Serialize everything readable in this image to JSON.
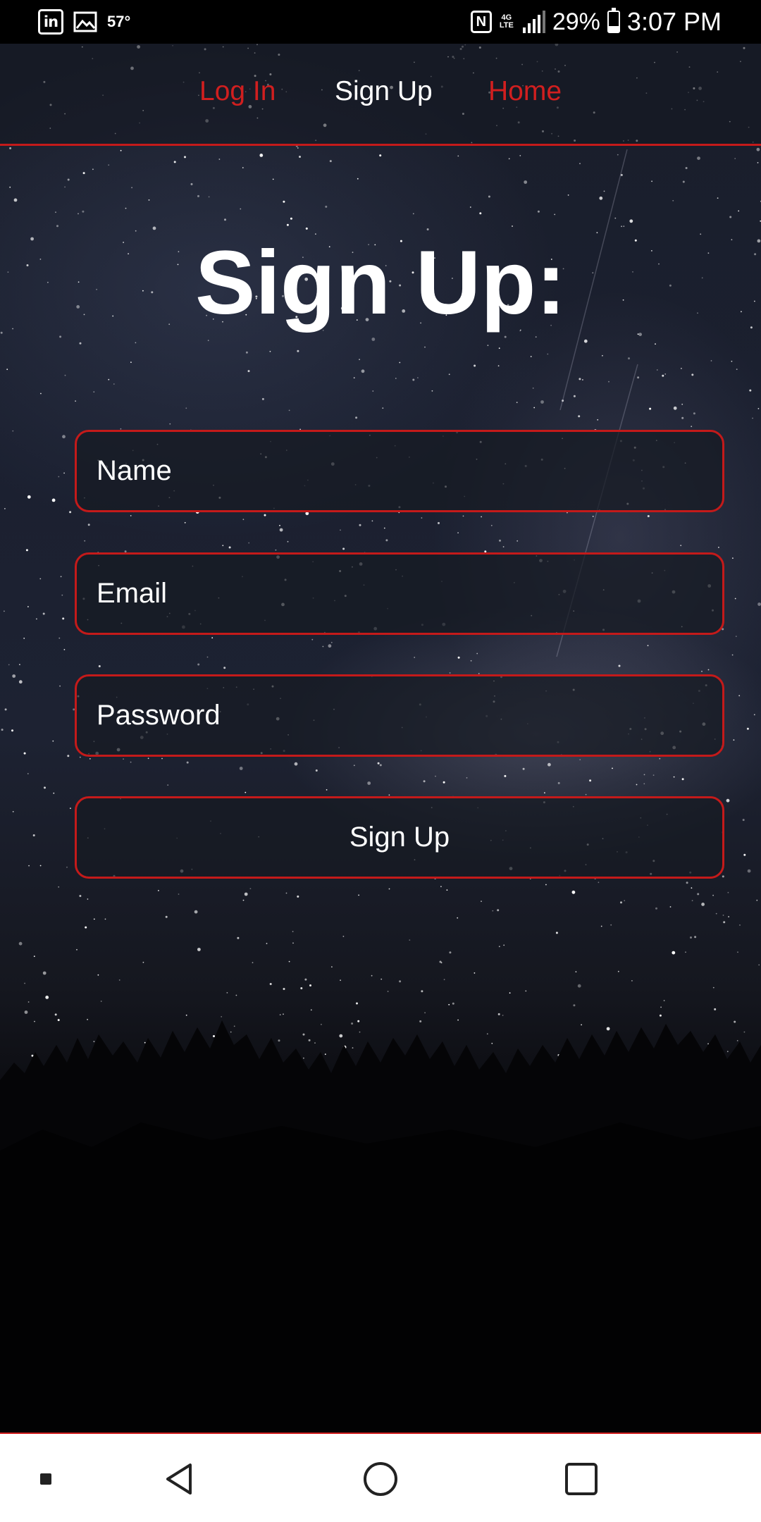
{
  "status_bar": {
    "temperature": "57°",
    "battery": "29%",
    "battery_level": 0.29,
    "time": "3:07 PM",
    "icons": [
      "linkedin-icon",
      "image-icon",
      "nfc-icon",
      "4g-lte-icon",
      "signal-icon",
      "battery-icon"
    ],
    "linkedin_text": "in",
    "nfc_text": "N",
    "lte_text": "4G\nLTE"
  },
  "nav": {
    "login": "Log In",
    "signup": "Sign Up",
    "home": "Home",
    "active_color": "#ffffff",
    "link_color": "#d11f1f"
  },
  "page": {
    "title": "Sign Up:"
  },
  "form": {
    "name_placeholder": "Name",
    "email_placeholder": "Email",
    "password_placeholder": "Password",
    "submit_label": "Sign Up",
    "border_color": "#c41a1a"
  },
  "android_nav": {
    "icons": [
      "recent-apps-dot-icon",
      "back-icon",
      "home-circle-icon",
      "overview-square-icon"
    ]
  }
}
